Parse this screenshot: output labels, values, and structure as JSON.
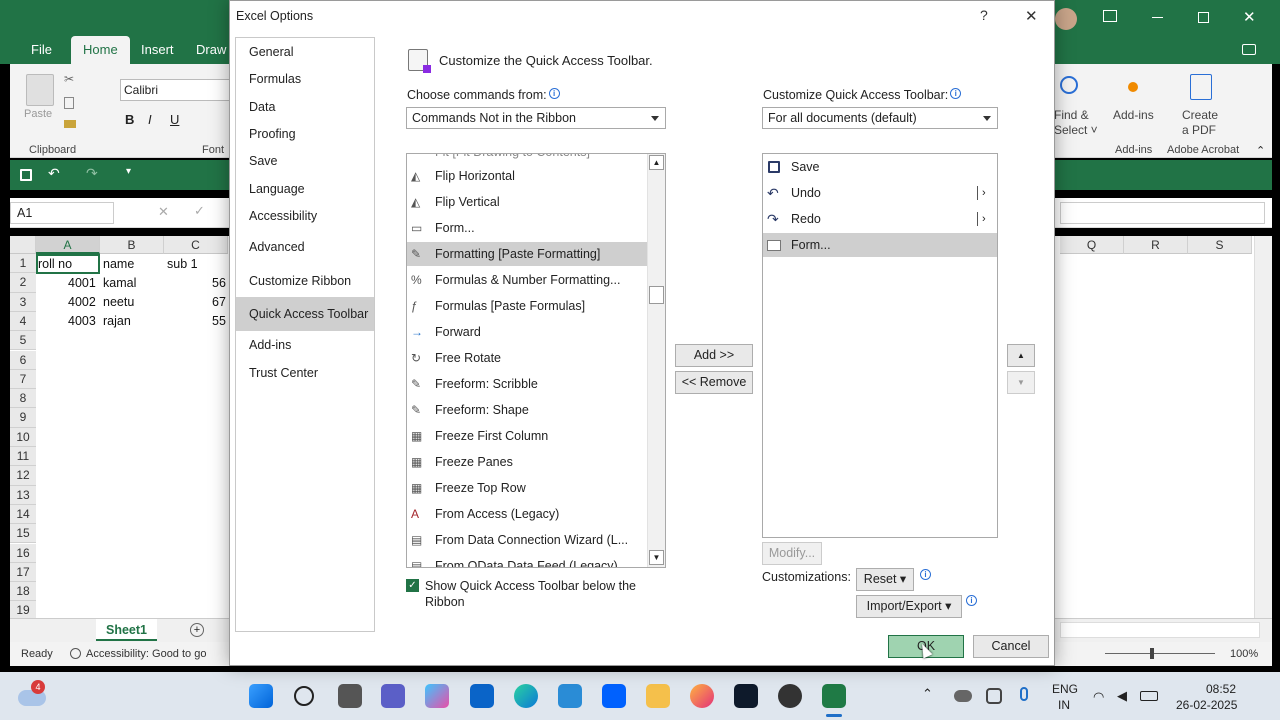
{
  "excel": {
    "tabs": [
      "File",
      "Home",
      "Insert",
      "Draw"
    ],
    "ribbon": {
      "paste": "Paste",
      "font_name": "Calibri",
      "clipboard": "Clipboard",
      "font": "Font",
      "find_select": "Find &",
      "find_select2": "Select ˅",
      "addins": "Add-ins",
      "create_pdf": "Create",
      "create_pdf2": "a PDF",
      "group_addins": "Add-ins",
      "group_acrobat": "Adobe Acrobat"
    },
    "namebox": "A1",
    "columns": [
      "A",
      "B",
      "C",
      "Q",
      "R",
      "S"
    ],
    "rows": [
      "1",
      "2",
      "3",
      "4",
      "5",
      "6",
      "7",
      "8",
      "9",
      "10",
      "11",
      "12",
      "13",
      "14",
      "15",
      "16",
      "17",
      "18",
      "19"
    ],
    "cells": [
      [
        "roll no",
        "name",
        "sub 1"
      ],
      [
        "4001",
        "kamal",
        "56"
      ],
      [
        "4002",
        "neetu",
        "67"
      ],
      [
        "4003",
        "rajan",
        "55"
      ]
    ],
    "sheet_tab": "Sheet1",
    "status_ready": "Ready",
    "status_access": "Accessibility: Good to go",
    "zoom": "100%"
  },
  "dialog": {
    "title": "Excel Options",
    "help": "?",
    "close": "✕",
    "nav": [
      "General",
      "Formulas",
      "Data",
      "Proofing",
      "Save",
      "Language",
      "Accessibility",
      "Advanced",
      "Customize Ribbon",
      "Quick Access Toolbar",
      "Add-ins",
      "Trust Center"
    ],
    "heading": "Customize the Quick Access Toolbar.",
    "choose_label": "Choose commands from:",
    "choose_value": "Commands Not in the Ribbon",
    "customize_label": "Customize Quick Access Toolbar:",
    "customize_value": "For all documents (default)",
    "commands_partial": "Fit [Fit Drawing to Contents]",
    "commands": [
      "Flip Horizontal",
      "Flip Vertical",
      "Form...",
      "Formatting [Paste Formatting]",
      "Formulas & Number Formatting...",
      "Formulas [Paste Formulas]",
      "Forward",
      "Free Rotate",
      "Freeform: Scribble",
      "Freeform: Shape",
      "Freeze First Column",
      "Freeze Panes",
      "Freeze Top Row",
      "From Access (Legacy)",
      "From Data Connection Wizard (L...",
      "From OData Data Feed (Legacy)"
    ],
    "qat_items": [
      "Save",
      "Undo",
      "Redo",
      "Form..."
    ],
    "add_button": "Add >>",
    "remove_button": "<< Remove",
    "modify_button": "Modify...",
    "customizations_label": "Customizations:",
    "reset_button": "Reset ▾",
    "import_export_button": "Import/Export ▾",
    "show_below_checkbox": "Show Quick Access Toolbar below the",
    "show_below_checkbox2": "Ribbon",
    "ok": "OK",
    "cancel": "Cancel"
  },
  "taskbar": {
    "badge": "4",
    "lang1": "ENG",
    "lang2": "IN",
    "time": "08:52",
    "date": "26-02-2025"
  }
}
